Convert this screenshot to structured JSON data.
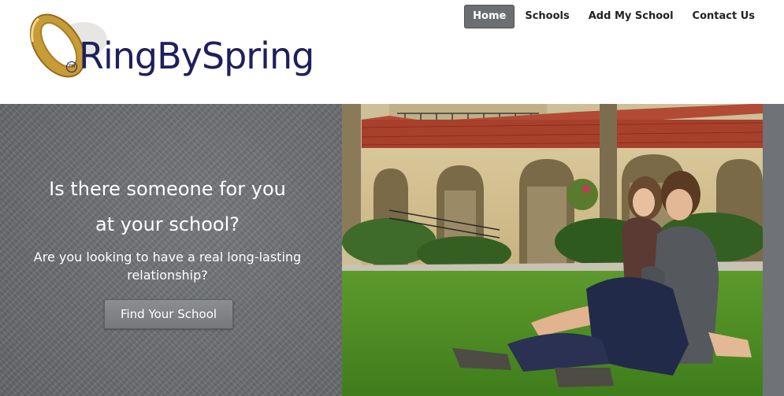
{
  "brand": {
    "name": "RingBySpring",
    "tm": "TM",
    "ring_color": "#b8902e",
    "text_color": "#1e1f5c"
  },
  "nav": {
    "items": [
      {
        "label": "Home",
        "active": true
      },
      {
        "label": "Schools",
        "active": false
      },
      {
        "label": "Add My School",
        "active": false
      },
      {
        "label": "Contact Us",
        "active": false
      }
    ]
  },
  "hero": {
    "headline_line1": "Is there someone for you",
    "headline_line2": "at your school?",
    "subline_line1": "Are you looking to have a real long-lasting",
    "subline_line2": "relationship?",
    "cta_label": "Find Your School",
    "photo": "couple-sitting-on-lawn-photo"
  }
}
